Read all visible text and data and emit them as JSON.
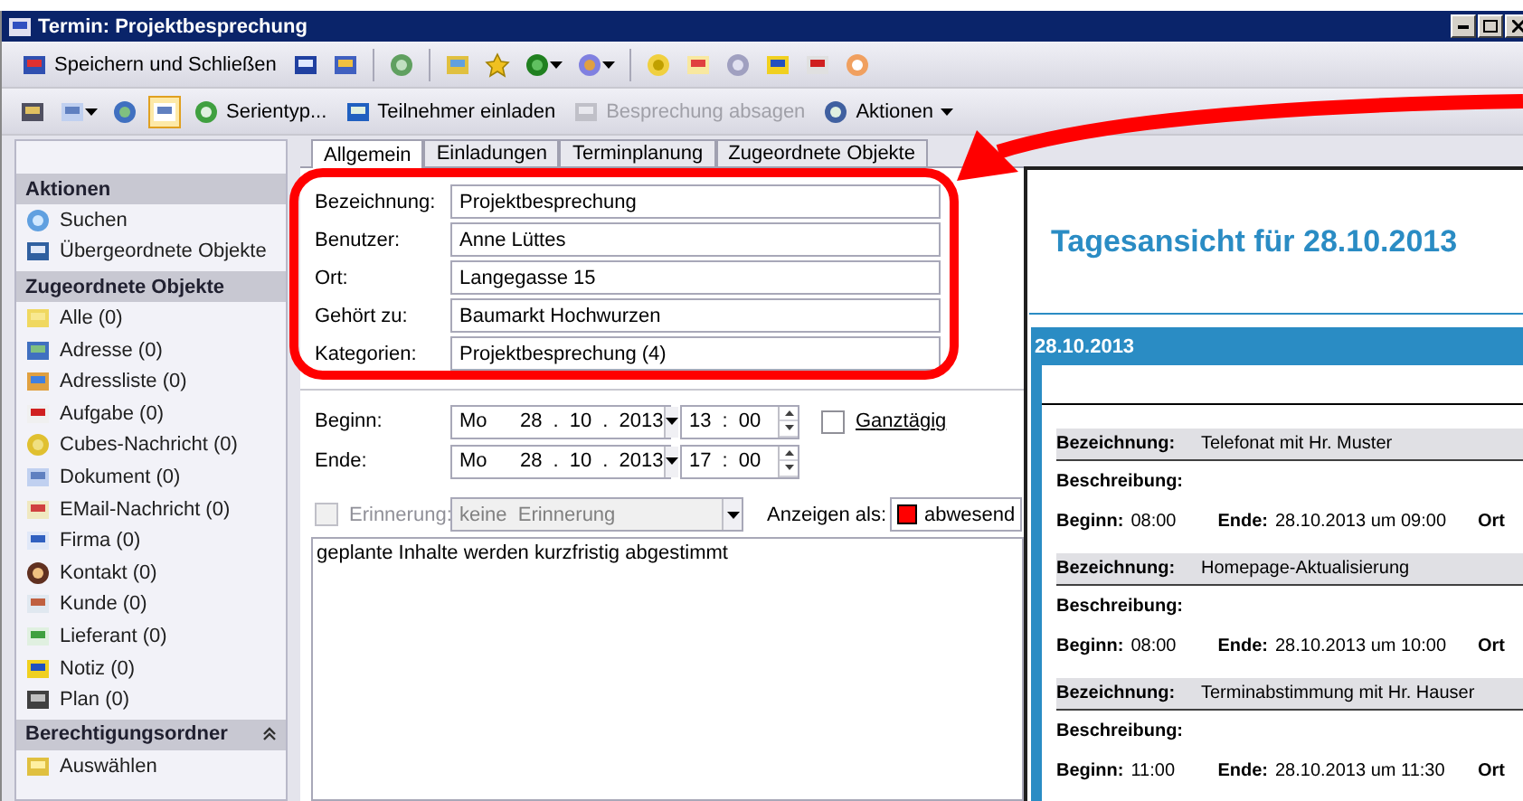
{
  "window": {
    "title": "Termin: Projektbesprechung"
  },
  "toolbar_1": {
    "save_close": "Speichern und Schließen"
  },
  "toolbar_2": {
    "items": [
      {
        "label": "Serientyp...",
        "disabled": false
      },
      {
        "label": "Teilnehmer einladen",
        "disabled": false
      },
      {
        "label": "Besprechung absagen",
        "disabled": true
      },
      {
        "label": "Aktionen",
        "disabled": false
      }
    ]
  },
  "sidebar": {
    "sections": [
      {
        "title": "Aktionen",
        "collapsible": false,
        "items": [
          "Suchen",
          "Übergeordnete Objekte"
        ]
      },
      {
        "title": "Zugeordnete Objekte",
        "collapsible": false,
        "items": [
          "Alle (0)",
          "Adresse (0)",
          "Adressliste (0)",
          "Aufgabe (0)",
          "Cubes-Nachricht (0)",
          "Dokument (0)",
          "EMail-Nachricht (0)",
          "Firma (0)",
          "Kontakt (0)",
          "Kunde (0)",
          "Lieferant (0)",
          "Notiz (0)",
          "Plan (0)"
        ]
      },
      {
        "title": "Berechtigungsordner",
        "collapsible": true,
        "items": [
          "Auswählen"
        ]
      }
    ]
  },
  "tabs": [
    {
      "label": "Allgemein",
      "selected": true
    },
    {
      "label": "Einladungen",
      "selected": false
    },
    {
      "label": "Terminplanung",
      "selected": false
    },
    {
      "label": "Zugeordnete Objekte",
      "selected": false
    }
  ],
  "fields": [
    {
      "label": "Bezeichnung:",
      "value": "Projektbesprechung"
    },
    {
      "label": "Benutzer:",
      "value": "Anne Lüttes"
    },
    {
      "label": "Ort:",
      "value": "Langegasse 15"
    },
    {
      "label": "Gehört zu:",
      "value": "Baumarkt Hochwurzen"
    },
    {
      "label": "Kategorien:",
      "value": "Projektbesprechung (4)"
    }
  ],
  "times": [
    {
      "label": "Beginn:",
      "weekday": "Mo",
      "date": "28 . 10 . 2013",
      "time": "13 : 00"
    },
    {
      "label": "Ende:",
      "weekday": "Mo",
      "date": "28 . 10 . 2013",
      "time": "17 : 00"
    }
  ],
  "all_day": {
    "label": "Ganztägig",
    "checked": false
  },
  "reminder": {
    "label": "Erinnerung:",
    "checked": false,
    "disabled": true,
    "value": "keine Erinnerung"
  },
  "show_as": {
    "label": "Anzeigen als:",
    "value": "abwesend",
    "color": "#ff0000"
  },
  "notes": "geplante Inhalte werden kurzfristig abgestimmt",
  "preview": {
    "title": "Tagesansicht für 28.10.2013",
    "date_header": "28.10.2013",
    "entries": [
      {
        "name_label": "Bezeichnung:",
        "name": "Telefonat mit Hr. Muster",
        "desc_label": "Beschreibung:",
        "start_label": "Beginn:",
        "start": "08:00",
        "end_label": "Ende:",
        "end": "28.10.2013 um 09:00",
        "place_label": "Ort"
      },
      {
        "name_label": "Bezeichnung:",
        "name": "Homepage-Aktualisierung",
        "desc_label": "Beschreibung:",
        "start_label": "Beginn:",
        "start": "08:00",
        "end_label": "Ende:",
        "end": "28.10.2013 um 10:00",
        "place_label": "Ort"
      },
      {
        "name_label": "Bezeichnung:",
        "name": "Terminabstimmung mit Hr. Hauser",
        "desc_label": "Beschreibung:",
        "start_label": "Beginn:",
        "start": "11:00",
        "end_label": "Ende:",
        "end": "28.10.2013 um 11:30",
        "place_label": "Ort"
      }
    ]
  }
}
